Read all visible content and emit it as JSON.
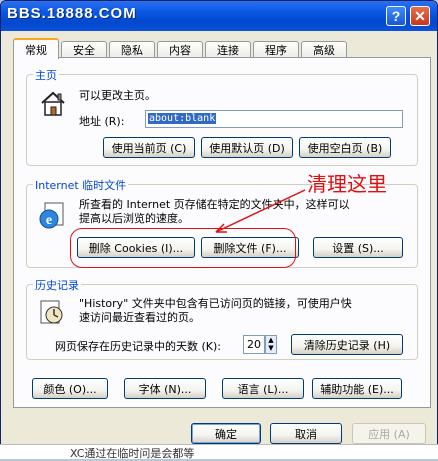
{
  "window": {
    "title": "BBS.18888.COM",
    "help_glyph": "?",
    "close_glyph": "✕"
  },
  "tabs": [
    "常规",
    "安全",
    "隐私",
    "内容",
    "连接",
    "程序",
    "高级"
  ],
  "homepage": {
    "section_title": "主页",
    "description": "可以更改主页。",
    "address_label": "地址 (R):",
    "address_value": "about:blank",
    "btn_current": "使用当前页 (C)",
    "btn_default": "使用默认页 (D)",
    "btn_blank": "使用空白页 (B)"
  },
  "temp_files": {
    "section_title": "Internet 临时文件",
    "description_line1": "所查看的 Internet 页存储在特定的文件夹中，这样可以",
    "description_line2": "提高以后浏览的速度。",
    "btn_delete_cookies": "删除 Cookies (I)...",
    "btn_delete_files": "删除文件 (F)...",
    "btn_settings": "设置 (S)..."
  },
  "history": {
    "section_title": "历史记录",
    "description_line1": "\"History\" 文件夹中包含有已访问页的链接，可使用户快",
    "description_line2": "速访问最近查看过的页。",
    "days_label": "网页保存在历史记录中的天数 (K):",
    "days_value": "20",
    "btn_clear": "清除历史记录 (H)"
  },
  "appearance_buttons": [
    "颜色 (O)...",
    "字体 (N)...",
    "语言 (L)...",
    "辅助功能 (E)..."
  ],
  "footer": {
    "ok": "确定",
    "cancel": "取消",
    "apply": "应用 (A)"
  },
  "annotation": {
    "text": "清理这里",
    "color": "#e01010"
  },
  "background_text": "XC通过在临时问是会都等"
}
